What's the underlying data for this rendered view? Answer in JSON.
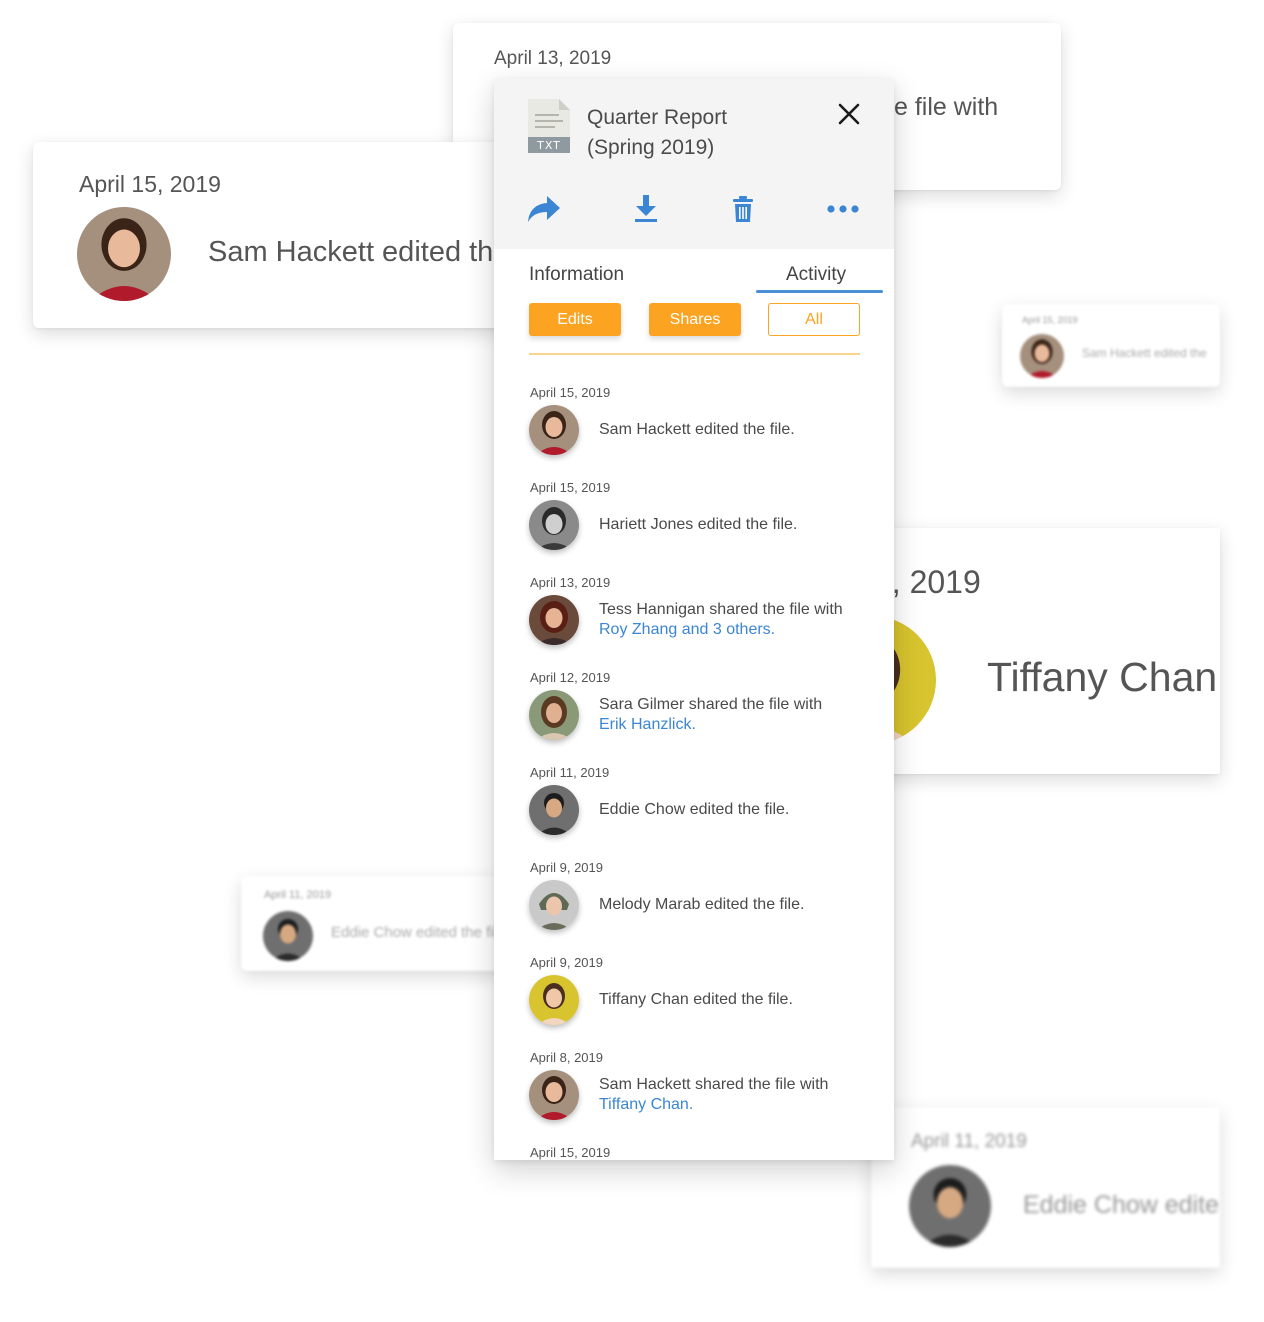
{
  "background_cards": {
    "card_a": {
      "date": "April 13, 2019",
      "text": "e file with"
    },
    "card_b": {
      "date": "April 15, 2019",
      "text": "Sam Hackett edited th"
    },
    "card_c": {
      "date": "April 15, 2019",
      "text": "Sam Hackett edited the"
    },
    "card_d": {
      "date": "9, 2019",
      "text": "Tiffany Chan"
    },
    "card_e": {
      "date": "April 11, 2019",
      "text": "Eddie Chow edited the file"
    },
    "card_f": {
      "date": "April 11, 2019",
      "text": "Eddie Chow edite"
    }
  },
  "panel": {
    "file_type": "TXT",
    "title_line1": "Quarter Report",
    "title_line2": "(Spring 2019)",
    "actions": [
      "share-icon",
      "download-icon",
      "trash-icon",
      "more-icon"
    ],
    "tabs": {
      "information": "Information",
      "activity": "Activity",
      "active": "activity"
    },
    "filters": {
      "edits": "Edits",
      "shares": "Shares",
      "all": "All",
      "selected": "all"
    },
    "colors": {
      "accent": "#fca321",
      "link": "#3b86d4",
      "action": "#3b86d4",
      "tab_underline": "#4a90d9"
    }
  },
  "activity": [
    {
      "date": "April 15, 2019",
      "text": "Sam Hackett edited the file.",
      "link": ""
    },
    {
      "date": "April 15, 2019",
      "text": "Hariett Jones edited the file.",
      "link": ""
    },
    {
      "date": "April 13, 2019",
      "text": "Tess Hannigan shared the file with",
      "link": "Roy Zhang and 3 others."
    },
    {
      "date": "April 12, 2019",
      "text": "Sara Gilmer shared the file with",
      "link": "Erik Hanzlick."
    },
    {
      "date": "April 11, 2019",
      "text": "Eddie Chow edited the file.",
      "link": ""
    },
    {
      "date": "April 9, 2019",
      "text": "Melody Marab edited the file.",
      "link": ""
    },
    {
      "date": "April 9, 2019",
      "text": "Tiffany Chan edited the file.",
      "link": ""
    },
    {
      "date": "April 8, 2019",
      "text": "Sam Hackett shared the file with",
      "link": "Tiffany Chan."
    },
    {
      "date": "April 15, 2019",
      "text": "",
      "link": ""
    }
  ]
}
